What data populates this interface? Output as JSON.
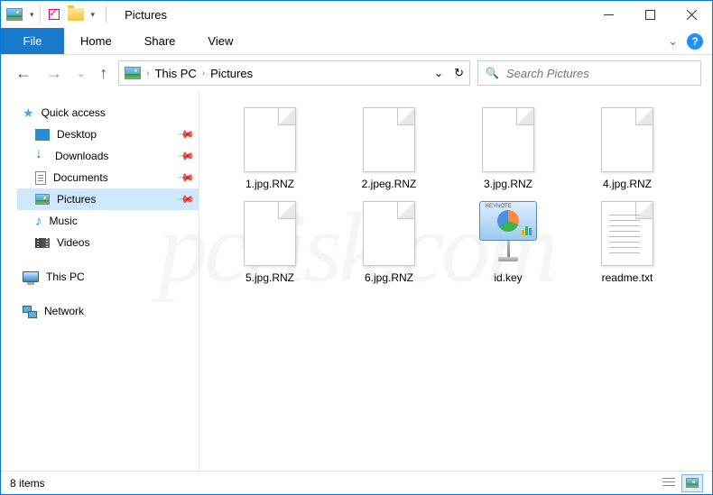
{
  "title_bar": {
    "title": "Pictures"
  },
  "ribbon": {
    "file": "File",
    "tabs": [
      "Home",
      "Share",
      "View"
    ]
  },
  "breadcrumb": {
    "root": "This PC",
    "current": "Pictures"
  },
  "search": {
    "placeholder": "Search Pictures"
  },
  "sidebar": {
    "quick_access": "Quick access",
    "items": [
      {
        "label": "Desktop",
        "pinned": true
      },
      {
        "label": "Downloads",
        "pinned": true
      },
      {
        "label": "Documents",
        "pinned": true
      },
      {
        "label": "Pictures",
        "pinned": true,
        "selected": true
      },
      {
        "label": "Music",
        "pinned": false
      },
      {
        "label": "Videos",
        "pinned": false
      }
    ],
    "this_pc": "This PC",
    "network": "Network"
  },
  "files": [
    {
      "name": "1.jpg.RNZ",
      "type": "blank"
    },
    {
      "name": "2.jpeg.RNZ",
      "type": "blank"
    },
    {
      "name": "3.jpg.RNZ",
      "type": "blank"
    },
    {
      "name": "4.jpg.RNZ",
      "type": "blank"
    },
    {
      "name": "5.jpg.RNZ",
      "type": "blank"
    },
    {
      "name": "6.jpg.RNZ",
      "type": "blank"
    },
    {
      "name": "id.key",
      "type": "key"
    },
    {
      "name": "readme.txt",
      "type": "txt"
    }
  ],
  "status": {
    "count": "8 items"
  },
  "keynote_label": "KEYNOTE"
}
